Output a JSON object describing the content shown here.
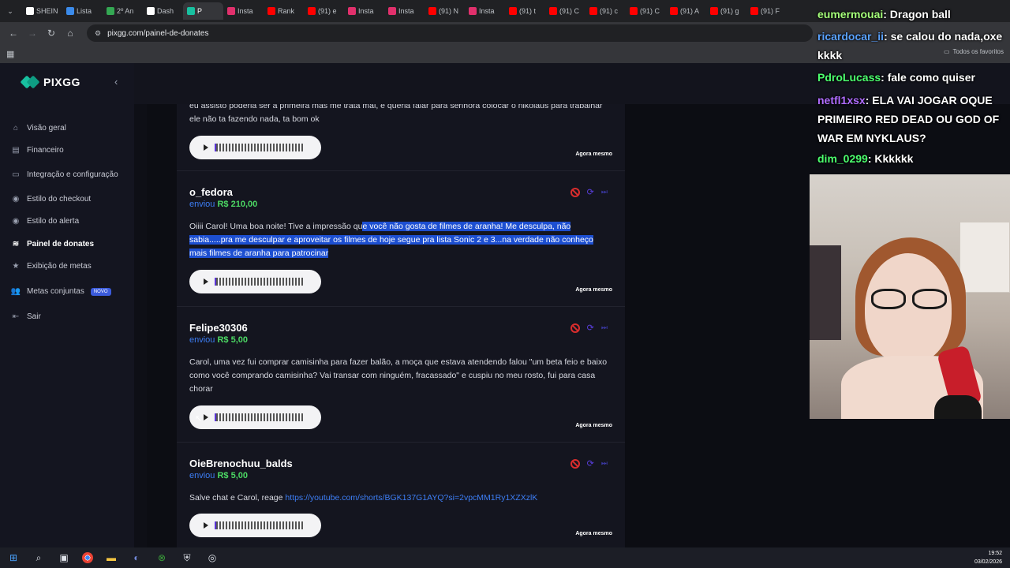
{
  "browser": {
    "tabs": [
      {
        "title": "SHEIN",
        "color": "#ffffff",
        "active": false
      },
      {
        "title": "Lista",
        "color": "#3b8beb",
        "active": false
      },
      {
        "title": "2º An",
        "color": "#34a853",
        "active": false
      },
      {
        "title": "Dash",
        "color": "#ffffff",
        "active": false
      },
      {
        "title": "P",
        "color": "#18c0a0",
        "active": true
      },
      {
        "title": "Insta",
        "color": "#e1306c",
        "active": false
      },
      {
        "title": "Rank",
        "color": "#ff0000",
        "active": false
      },
      {
        "title": "(91) e",
        "color": "#ff0000",
        "active": false
      },
      {
        "title": "Insta",
        "color": "#e1306c",
        "active": false
      },
      {
        "title": "Insta",
        "color": "#e1306c",
        "active": false
      },
      {
        "title": "(91) N",
        "color": "#ff0000",
        "active": false
      },
      {
        "title": "Insta",
        "color": "#e1306c",
        "active": false
      },
      {
        "title": "(91) t",
        "color": "#ff0000",
        "active": false
      },
      {
        "title": "(91) C",
        "color": "#ff0000",
        "active": false
      },
      {
        "title": "(91) c",
        "color": "#ff0000",
        "active": false
      },
      {
        "title": "(91) C",
        "color": "#ff0000",
        "active": false
      },
      {
        "title": "(91) A",
        "color": "#ff0000",
        "active": false
      },
      {
        "title": "(91) g",
        "color": "#ff0000",
        "active": false
      },
      {
        "title": "(91) F",
        "color": "#ff0000",
        "active": false
      }
    ],
    "url": "pixgg.com/painel-de-donates",
    "favorites_label": "Todos os favoritos"
  },
  "app": {
    "logo": "PIXGG",
    "menu": [
      {
        "label": "Visão geral",
        "icon": "home-icon",
        "glyph": "⌂",
        "name": "sidebar-item-visao-geral"
      },
      {
        "label": "Financeiro",
        "icon": "wallet-icon",
        "glyph": "▤",
        "name": "sidebar-item-financeiro"
      },
      {
        "label": "Integração e configuração",
        "icon": "settings-icon",
        "glyph": "▭",
        "name": "sidebar-item-integracao"
      },
      {
        "label": "Estilo do checkout",
        "icon": "palette-icon",
        "glyph": "◉",
        "name": "sidebar-item-estilo-checkout"
      },
      {
        "label": "Estilo do alerta",
        "icon": "palette-icon",
        "glyph": "◉",
        "name": "sidebar-item-estilo-alerta"
      },
      {
        "label": "Painel de donates",
        "icon": "list-icon",
        "glyph": "≋",
        "name": "sidebar-item-painel-donates",
        "active": true
      },
      {
        "label": "Exibição de metas",
        "icon": "star-icon",
        "glyph": "★",
        "name": "sidebar-item-exibicao-metas"
      },
      {
        "label": "Metas conjuntas",
        "icon": "group-icon",
        "glyph": "👥",
        "name": "sidebar-item-metas-conjuntas",
        "badge": "NOVO"
      },
      {
        "label": "Sair",
        "icon": "logout-icon",
        "glyph": "⇤",
        "name": "sidebar-item-sair"
      }
    ]
  },
  "donations": [
    {
      "partial": true,
      "message": "eu assisto poderia ser a primeira mas me trata mal, e queria falar para senhora colocar o nikolaus para trabalhar ele não ta fazendo nada, ta bom ok",
      "time": "Agora mesmo"
    },
    {
      "donor": "o_fedora",
      "sent_label": "enviou",
      "amount": "R$ 210,00",
      "message_plain": "Oiiii Carol! Uma boa noite! Tive a impressão qu",
      "message_highlight": "e você não gosta de filmes de aranha! Me desculpa, não sabia.....pra me desculpar e aproveitar os filmes de hoje segue pra lista Sonic 2 e 3...na verdade não conheço mais filmes de aranha para patrocinar",
      "time": "Agora mesmo"
    },
    {
      "donor": "Felipe30306",
      "sent_label": "enviou",
      "amount": "R$ 5,00",
      "message": "Carol, uma vez fui comprar camisinha para fazer balão, a moça que estava atendendo falou \"um beta feio e baixo como você comprando camisinha? Vai transar com ninguém, fracassado\" e cuspiu no meu rosto, fui para casa chorar",
      "time": "Agora mesmo"
    },
    {
      "donor": "OieBrenochuu_balds",
      "sent_label": "enviou",
      "amount": "R$ 5,00",
      "message_plain": "Salve chat e Carol, reage ",
      "message_link": "https://youtube.com/shorts/BGK137G1AYQ?si=2vpcMM1Ry1XZXzlK",
      "time": "Agora mesmo"
    }
  ],
  "chat": [
    {
      "user": "eumermouai",
      "text": ": Dragon ball",
      "color": "#a5ff7a"
    },
    {
      "user": "ricardocar_ii",
      "text": ": se calou do nada,oxe kkkk",
      "color": "#5aa2ff"
    },
    {
      "user": "PdroLucass",
      "text": ": fale como quiser",
      "color": "#4cff6e"
    },
    {
      "user": "netfl1xsx",
      "text": ": ELA VAI JOGAR OQUE PRIMEIRO RED DEAD OU GOD OF WAR EM NYKLAUS?",
      "color": "#b06cff"
    },
    {
      "user": "dim_0299",
      "text": ": Kkkkkk",
      "color": "#4cff6e"
    }
  ],
  "taskbar": {
    "time": "19:52",
    "date": "03/02/2026"
  }
}
